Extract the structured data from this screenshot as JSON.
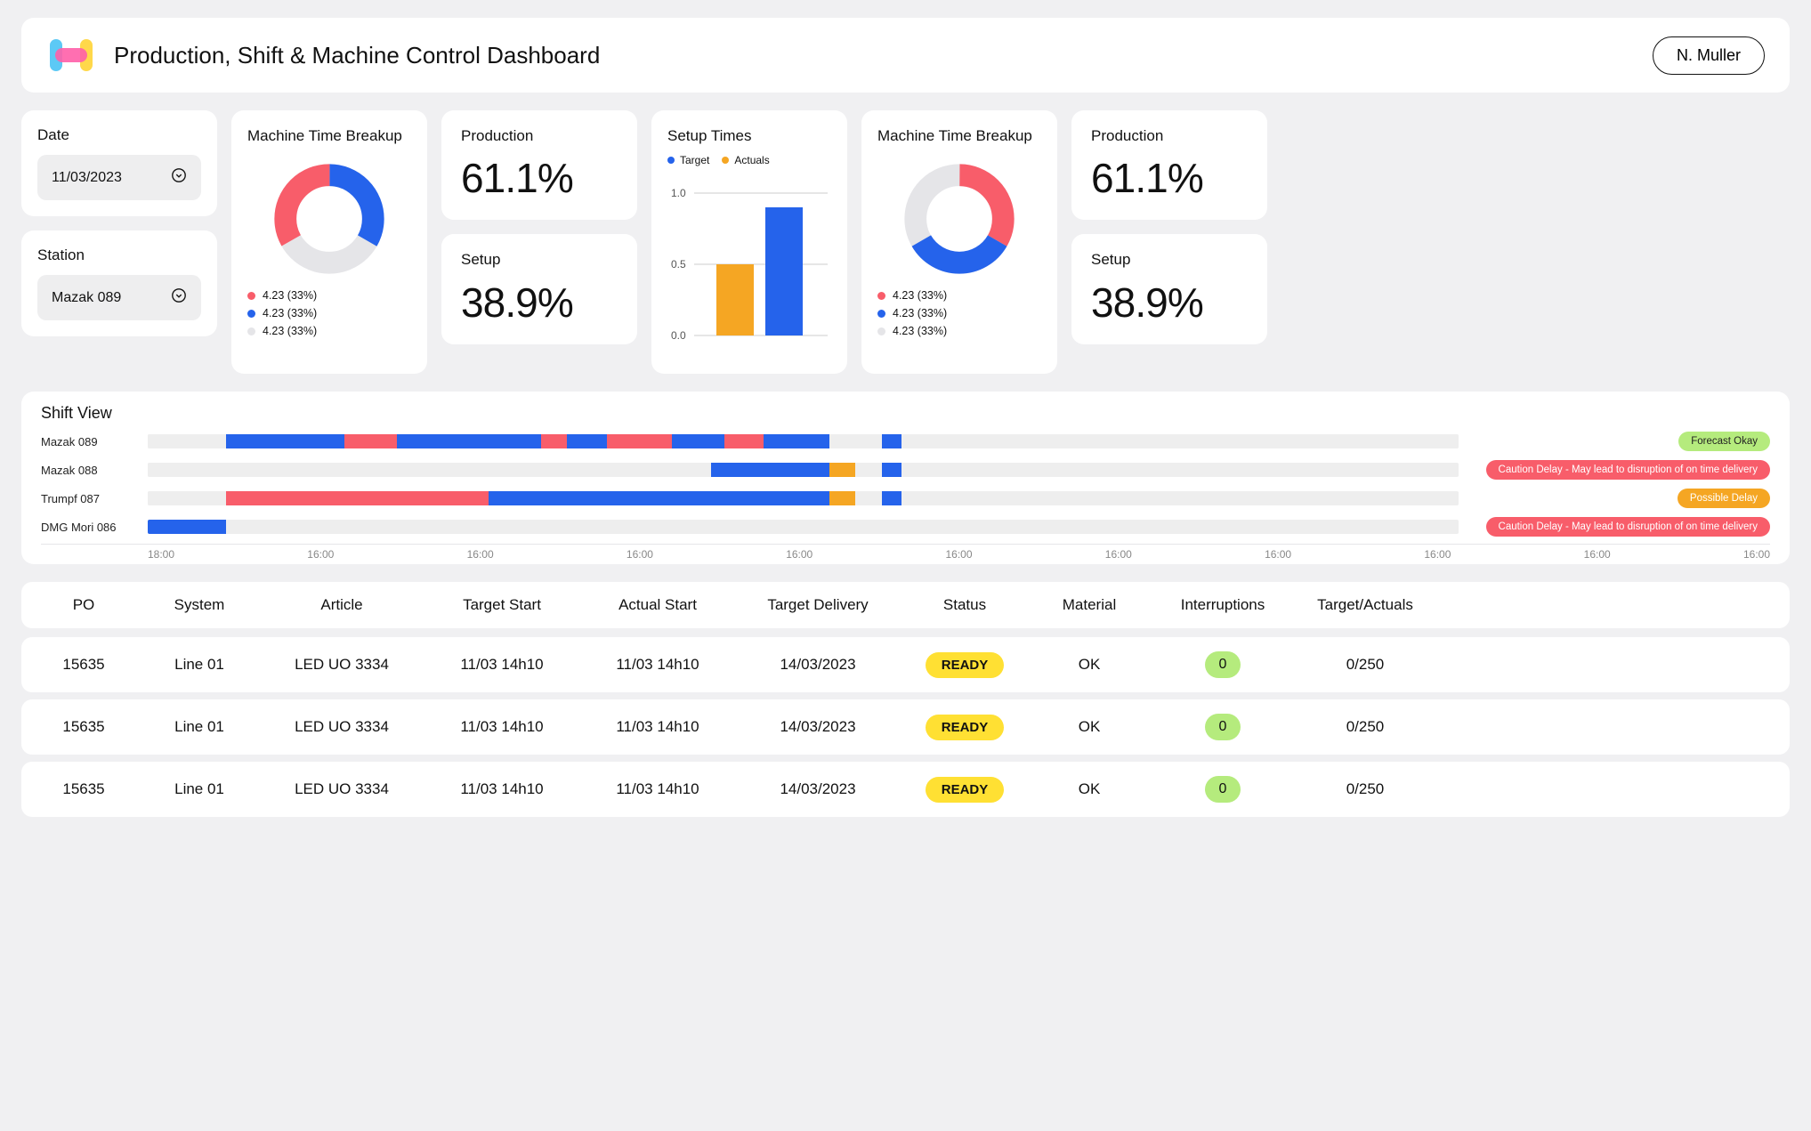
{
  "header": {
    "title": "Production, Shift & Machine Control Dashboard",
    "user": "N. Muller"
  },
  "filters": {
    "date_label": "Date",
    "date_value": "11/03/2023",
    "station_label": "Station",
    "station_value": "Mazak 089"
  },
  "donut1": {
    "title": "Machine Time Breakup",
    "legend": [
      {
        "color": "#f85d6a",
        "label": "4.23 (33%)"
      },
      {
        "color": "#2563eb",
        "label": "4.23 (33%)"
      },
      {
        "color": "#e5e5e8",
        "label": "4.23 (33%)"
      }
    ]
  },
  "donut2": {
    "title": "Machine Time Breakup",
    "legend": [
      {
        "color": "#f85d6a",
        "label": "4.23 (33%)"
      },
      {
        "color": "#2563eb",
        "label": "4.23 (33%)"
      },
      {
        "color": "#e5e5e8",
        "label": "4.23 (33%)"
      }
    ]
  },
  "stats1": {
    "production_label": "Production",
    "production_value": "61.1%",
    "setup_label": "Setup",
    "setup_value": "38.9%"
  },
  "stats2": {
    "production_label": "Production",
    "production_value": "61.1%",
    "setup_label": "Setup",
    "setup_value": "38.9%"
  },
  "setup_times": {
    "title": "Setup Times",
    "legend_target": "Target",
    "legend_actuals": "Actuals",
    "y_ticks": [
      "1.0",
      "0.5",
      "0.0"
    ]
  },
  "shift": {
    "title": "Shift View",
    "machines": [
      "Mazak 089",
      "Mazak 088",
      "Trumpf 087",
      "DMG Mori 086"
    ],
    "badges": [
      {
        "class": "green",
        "text": "Forecast Okay"
      },
      {
        "class": "red",
        "text": "Caution Delay - May lead to disruption of on time delivery"
      },
      {
        "class": "orange",
        "text": "Possible Delay"
      },
      {
        "class": "red",
        "text": "Caution Delay - May lead to disruption of on time delivery"
      }
    ],
    "axis": [
      "18:00",
      "16:00",
      "16:00",
      "16:00",
      "16:00",
      "16:00",
      "16:00",
      "16:00",
      "16:00",
      "16:00",
      "16:00"
    ]
  },
  "table": {
    "cols": [
      "PO",
      "System",
      "Article",
      "Target Start",
      "Actual Start",
      "Target Delivery",
      "Status",
      "Material",
      "Interruptions",
      "Target/Actuals"
    ],
    "rows": [
      {
        "po": "15635",
        "system": "Line 01",
        "article": "LED UO 3334",
        "tstart": "11/03 14h10",
        "astart": "11/03 14h10",
        "tdeliv": "14/03/2023",
        "status": "READY",
        "material": "OK",
        "interrupt": "0",
        "ta": "0/250"
      },
      {
        "po": "15635",
        "system": "Line 01",
        "article": "LED UO 3334",
        "tstart": "11/03 14h10",
        "astart": "11/03 14h10",
        "tdeliv": "14/03/2023",
        "status": "READY",
        "material": "OK",
        "interrupt": "0",
        "ta": "0/250"
      },
      {
        "po": "15635",
        "system": "Line 01",
        "article": "LED UO 3334",
        "tstart": "11/03 14h10",
        "astart": "11/03 14h10",
        "tdeliv": "14/03/2023",
        "status": "READY",
        "material": "OK",
        "interrupt": "0",
        "ta": "0/250"
      }
    ]
  },
  "chart_data": [
    {
      "type": "pie",
      "title": "Machine Time Breakup",
      "series": [
        {
          "name": "Red",
          "value": 4.23,
          "percent": 33,
          "color": "#f85d6a"
        },
        {
          "name": "Blue",
          "value": 4.23,
          "percent": 33,
          "color": "#2563eb"
        },
        {
          "name": "Grey",
          "value": 4.23,
          "percent": 33,
          "color": "#e5e5e8"
        }
      ]
    },
    {
      "type": "bar",
      "title": "Setup Times",
      "categories": [
        "Actuals",
        "Target"
      ],
      "series": [
        {
          "name": "Actuals",
          "values": [
            0.5
          ],
          "color": "#f5a623"
        },
        {
          "name": "Target",
          "values": [
            0.9
          ],
          "color": "#2563eb"
        }
      ],
      "ylim": [
        0,
        1.0
      ],
      "y_ticks": [
        0.0,
        0.5,
        1.0
      ]
    },
    {
      "type": "pie",
      "title": "Machine Time Breakup",
      "series": [
        {
          "name": "Red",
          "value": 4.23,
          "percent": 33,
          "color": "#f85d6a"
        },
        {
          "name": "Blue",
          "value": 4.23,
          "percent": 33,
          "color": "#2563eb"
        },
        {
          "name": "Grey",
          "value": 4.23,
          "percent": 33,
          "color": "#e5e5e8"
        }
      ]
    }
  ]
}
